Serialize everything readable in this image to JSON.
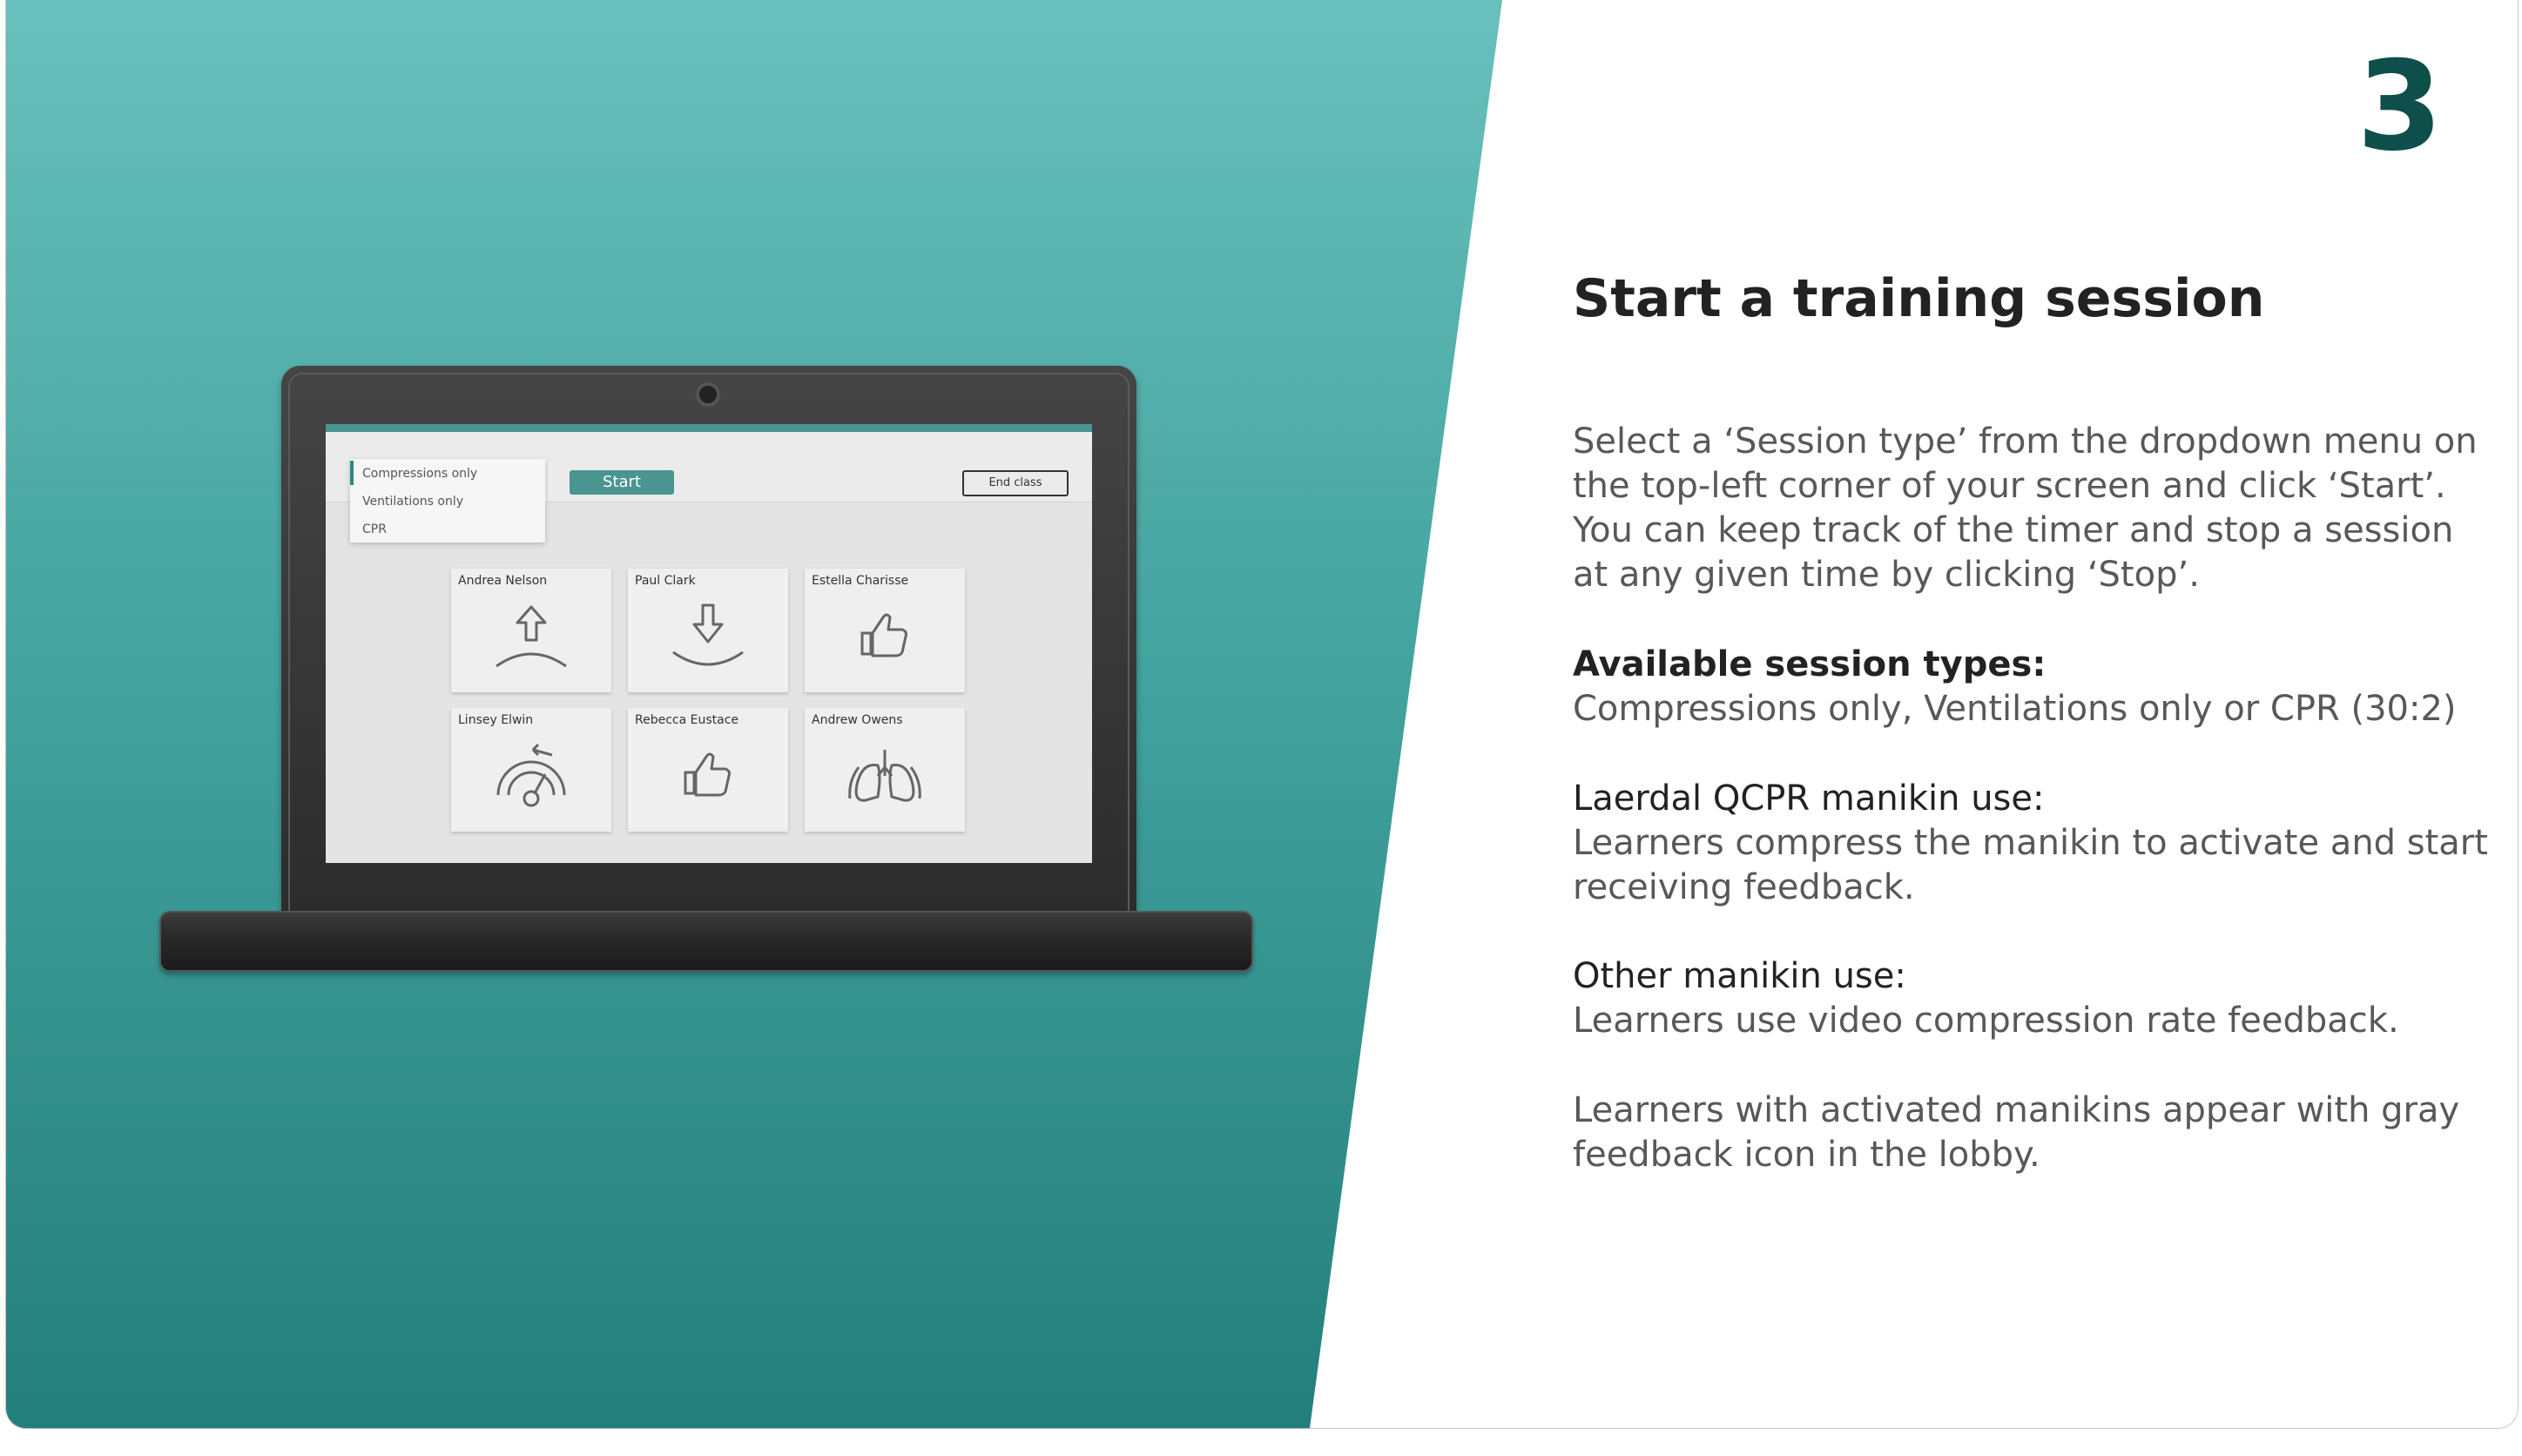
{
  "slide": {
    "page_number": "3",
    "title": "Start a training session",
    "intro": "Select a ‘Session type’ from the dropdown menu on the top-left corner of your screen and click ‘Start’. You can keep track of the timer and stop a session at any given time by clicking ‘Stop’.",
    "session_types_heading": "Available session types:",
    "session_types_text": "Compressions only, Ventilations only or CPR (30:2)",
    "qcpr_heading": "Laerdal QCPR manikin use:",
    "qcpr_text": "Learners compress the manikin to activate and start receiving feedback.",
    "other_heading": "Other manikin use:",
    "other_text": "Learners use video compression rate feedback.",
    "note": "Learners with activated manikins appear with gray feedback icon in the lobby."
  },
  "app": {
    "dropdown_options": [
      "Compressions only",
      "Ventilations only",
      "CPR"
    ],
    "start_label": "Start",
    "end_class_label": "End class",
    "learners": [
      {
        "name": "Andrea Nelson",
        "icon": "arrow-up-icon"
      },
      {
        "name": "Paul Clark",
        "icon": "arrow-down-icon"
      },
      {
        "name": "Estella Charisse",
        "icon": "thumbs-up-icon"
      },
      {
        "name": "Linsey Elwin",
        "icon": "gauge-icon"
      },
      {
        "name": "Rebecca Eustace",
        "icon": "thumbs-up-icon"
      },
      {
        "name": "Andrew Owens",
        "icon": "lungs-icon"
      }
    ]
  },
  "colors": {
    "accent": "#4a958f",
    "teal_light": "#69c0bc",
    "teal_dark": "#237f7b",
    "page_number": "#0f4f4b"
  }
}
